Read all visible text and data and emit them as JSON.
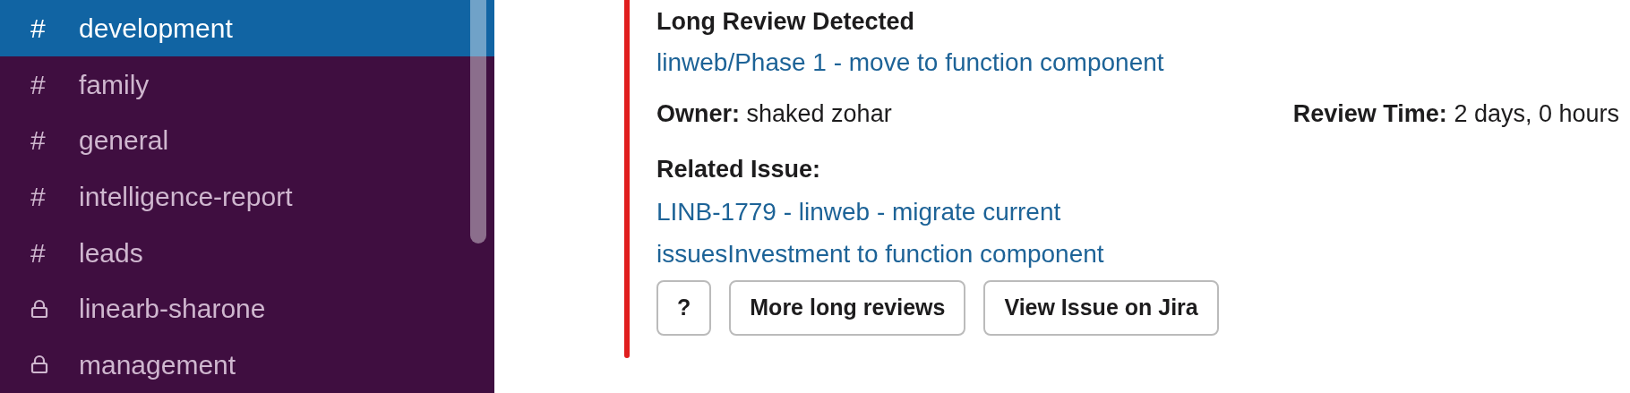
{
  "sidebar": {
    "channels": [
      {
        "kind": "public",
        "name": "development",
        "selected": true
      },
      {
        "kind": "public",
        "name": "family",
        "selected": false
      },
      {
        "kind": "public",
        "name": "general",
        "selected": false
      },
      {
        "kind": "public",
        "name": "intelligence-report",
        "selected": false
      },
      {
        "kind": "public",
        "name": "leads",
        "selected": false
      },
      {
        "kind": "private",
        "name": "linearb-sharone",
        "selected": false
      },
      {
        "kind": "private",
        "name": "management",
        "selected": false
      }
    ],
    "hash_glyph": "#"
  },
  "message": {
    "title": "Long Review Detected",
    "pr_link": "linweb/Phase 1 - move to function component",
    "fields": [
      {
        "label": "Owner:",
        "value": "shaked zohar"
      },
      {
        "label": "Review Time:",
        "value": "2 days, 0 hours"
      }
    ],
    "related_label": "Related Issue:",
    "issue_lines": [
      "LINB-1779 - linweb - migrate current",
      "issuesInvestment to function component"
    ],
    "buttons": [
      "?",
      "More long reviews",
      "View Issue on Jira"
    ]
  }
}
